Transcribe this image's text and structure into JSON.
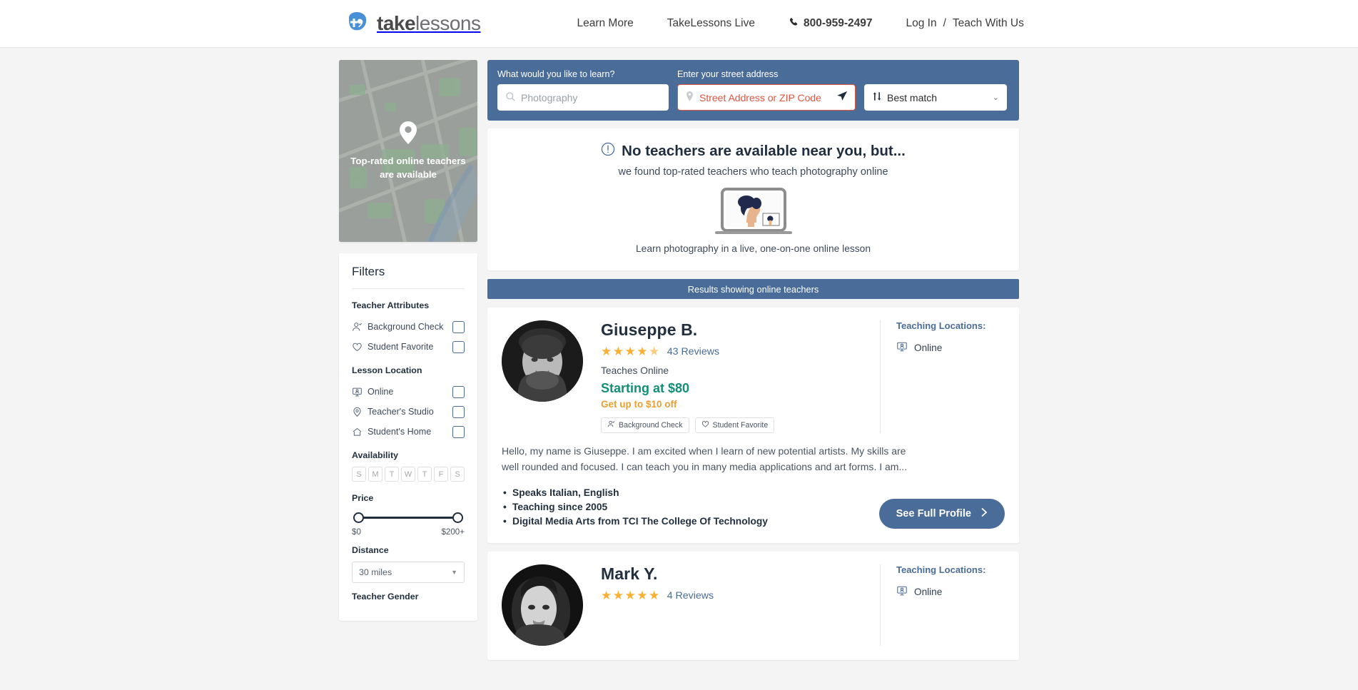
{
  "header": {
    "logo_text_bold": "take",
    "logo_text_light": "lessons",
    "nav": [
      {
        "label": "Learn More"
      },
      {
        "label": "TakeLessons Live"
      }
    ],
    "phone": "800-959-2497",
    "login": "Log In",
    "separator": "/",
    "teach": "Teach With Us"
  },
  "sidebar": {
    "map": {
      "overlay_line1": "Top-rated online teachers",
      "overlay_line2": "are available",
      "pin_icon": "map-pin-icon"
    },
    "filters_title": "Filters",
    "groups": [
      {
        "title": "Teacher Attributes",
        "items": [
          {
            "label": "Background Check",
            "icon": "user-check-icon",
            "checked": false
          },
          {
            "label": "Student Favorite",
            "icon": "heart-icon",
            "checked": false
          }
        ]
      },
      {
        "title": "Lesson Location",
        "items": [
          {
            "label": "Online",
            "icon": "monitor-person-icon",
            "checked": false
          },
          {
            "label": "Teacher's Studio",
            "icon": "map-pin-icon",
            "checked": false
          },
          {
            "label": "Student's Home",
            "icon": "home-icon",
            "checked": false
          }
        ]
      }
    ],
    "availability": {
      "title": "Availability",
      "days": [
        "S",
        "M",
        "T",
        "W",
        "T",
        "F",
        "S"
      ]
    },
    "price": {
      "title": "Price",
      "min_label": "$0",
      "max_label": "$200+"
    },
    "distance": {
      "title": "Distance",
      "value": "30 miles",
      "caret_icon": "caret-down-icon"
    },
    "gender": {
      "title": "Teacher Gender"
    }
  },
  "search": {
    "subject_label": "What would you like to learn?",
    "subject_placeholder": "Photography",
    "subject_icon": "search-icon",
    "address_label": "Enter your street address",
    "address_placeholder": "Street Address or ZIP Code",
    "address_pin_icon": "map-pin-icon",
    "address_locate_icon": "navigation-arrow-icon",
    "sort_value": "Best match",
    "sort_icon": "sort-updown-icon",
    "sort_caret_icon": "chevron-down-icon"
  },
  "notice": {
    "alert_icon": "alert-circle-icon",
    "headline": "No teachers are available near you, but...",
    "subline": "we found top-rated teachers who teach photography online",
    "illustration": "laptop-video-lesson-illustration",
    "footline": "Learn photography in a live, one-on-one online lesson"
  },
  "results_bar": "Results showing online teachers",
  "teachers": [
    {
      "name": "Giuseppe B.",
      "stars_filled": 5,
      "stars_display": "★★★★",
      "last_star": "★",
      "reviews": "43 Reviews",
      "teaches": "Teaches Online",
      "price": "Starting at $80",
      "promo": "Get up to $10 off",
      "badges": [
        {
          "label": "Background Check",
          "icon": "user-check-icon"
        },
        {
          "label": "Student Favorite",
          "icon": "heart-icon"
        }
      ],
      "teaching_locations_title": "Teaching Locations:",
      "locations": [
        {
          "label": "Online",
          "icon": "monitor-person-icon"
        }
      ],
      "bio": "Hello, my name is Giuseppe. I am excited when I learn of new potential artists. My skills are well rounded and focused. I can teach you in many media applications and art forms. I am...",
      "bullets": [
        "Speaks Italian, English",
        "Teaching since 2005",
        "Digital Media Arts from TCI The College Of Technology"
      ],
      "cta": "See Full Profile",
      "cta_icon": "chevron-right-icon"
    },
    {
      "name": "Mark Y.",
      "stars_filled": 5,
      "reviews": "4 Reviews",
      "teaching_locations_title": "Teaching Locations:",
      "locations": [
        {
          "label": "Online",
          "icon": "monitor-person-icon"
        }
      ]
    }
  ],
  "colors": {
    "brand_blue": "#4a6c98",
    "logo_blue": "#4a90d9",
    "price_green": "#148f77",
    "promo_orange": "#e8a033",
    "star_gold": "#fbb034",
    "error_red": "#e0553d",
    "page_bg": "#f4f4f4"
  }
}
